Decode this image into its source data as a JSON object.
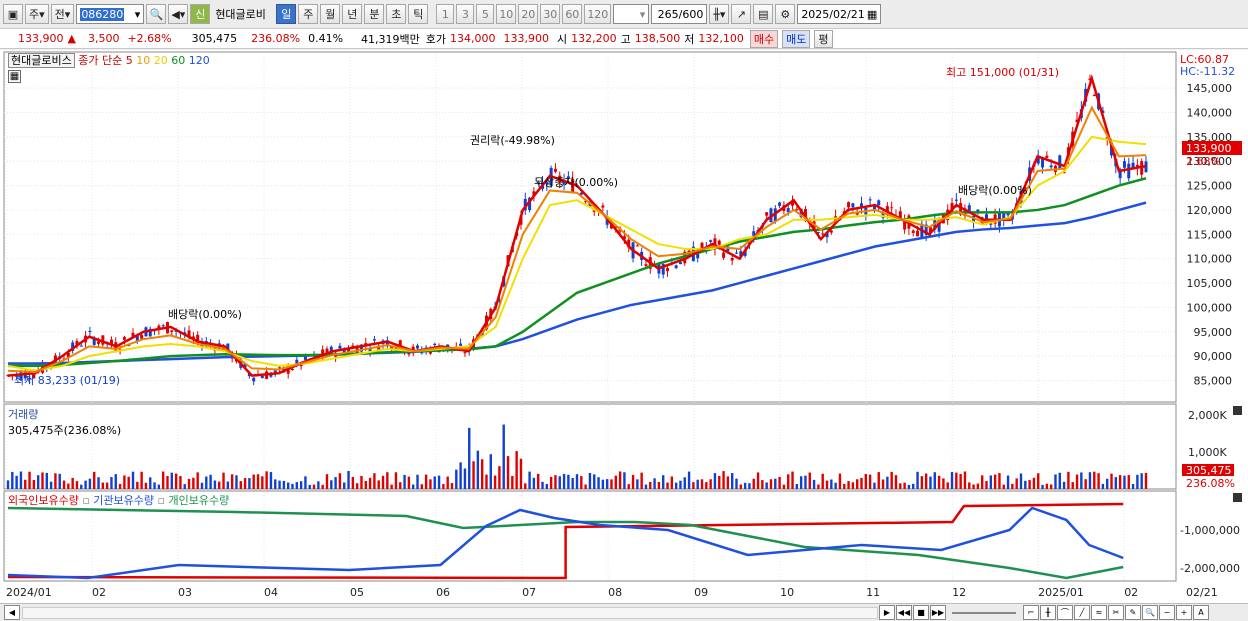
{
  "toolbar": {
    "period_btn": "주",
    "prev_btn": "전",
    "stock_code": "086280",
    "new_badge": "신",
    "stock_name": "현대글로비",
    "tabs": [
      "일",
      "주",
      "월",
      "년",
      "분",
      "초",
      "틱"
    ],
    "active_tab": "일",
    "intervals": [
      "1",
      "3",
      "5",
      "10",
      "20",
      "30",
      "60",
      "120"
    ],
    "count_value": "265",
    "count_total": "/600",
    "date": "2025/02/21"
  },
  "quote": {
    "price": "133,900",
    "change": "3,500",
    "change_pct": "+2.68%",
    "volume": "305,475",
    "volume_ratio": "236.08%",
    "turnover": "0.41%",
    "amount": "41,319백만",
    "bid_label": "호가",
    "bid1": "134,000",
    "bid2": "133,900",
    "open_label": "시",
    "open": "132,200",
    "high_label": "고",
    "high": "138,500",
    "low_label": "저",
    "low": "132,100",
    "buy_btn": "매수",
    "sell_btn": "매도",
    "eval_btn": "평"
  },
  "price_panel": {
    "name_box": "현대글로비스",
    "legend_prefix": "종가 단순",
    "ma_labels": [
      "5",
      "10",
      "20",
      "60",
      "120"
    ],
    "lc": "LC:60.87",
    "hc": "HC:-11.32",
    "current_price_tag": "133,900",
    "current_pct_tag": "2.68%",
    "annotations": {
      "high": "최고 151,000 (01/31)",
      "low": "최저 83,233 (01/19)",
      "div1": "배당락(0.00%)",
      "rights": "권리락(-49.98%)",
      "bonus": "무상증자(0.00%)",
      "div2": "배당락(0.00%)"
    }
  },
  "volume_panel": {
    "title": "거래량",
    "current": "305,475주(236.08%)",
    "axis_labels": [
      "2,000K",
      "1,000K"
    ],
    "tag_value": "305,475",
    "tag_pct": "236.08%"
  },
  "holdings_panel": {
    "legends": [
      "외국인보유수량",
      "기관보유수량",
      "개인보유수량"
    ],
    "axis_labels": [
      "-1,000,000",
      "-2,000,000"
    ]
  },
  "x_axis": [
    "2024/01",
    "02",
    "03",
    "04",
    "05",
    "06",
    "07",
    "08",
    "09",
    "10",
    "11",
    "12",
    "2025/01",
    "02"
  ],
  "x_axis_right": "02/21",
  "colors": {
    "ma5": "#e00000",
    "ma10": "#f08000",
    "ma20": "#f0e000",
    "ma60": "#109020",
    "ma120": "#2050e0",
    "up": "#e00000",
    "down": "#1040d0",
    "foreign": "#e00000",
    "institution": "#2050e0",
    "individual": "#209050"
  },
  "chart_data": {
    "type": "candlestick",
    "y_axis_labels": [
      "145,000",
      "140,000",
      "135,000",
      "130,000",
      "125,000",
      "120,000",
      "115,000",
      "110,000",
      "105,000",
      "100,000",
      "95,000",
      "90,000",
      "85,000"
    ],
    "ylim": [
      81000,
      152000
    ],
    "ma5": [
      86000,
      86500,
      90000,
      94000,
      92000,
      95000,
      96000,
      93000,
      92000,
      86000,
      86500,
      89000,
      91000,
      92000,
      93000,
      91000,
      92000,
      91000,
      100000,
      120000,
      127000,
      125000,
      119000,
      112000,
      108000,
      110000,
      113000,
      110000,
      118000,
      122000,
      114000,
      120000,
      121000,
      118000,
      115000,
      121000,
      118000,
      118000,
      131000,
      129000,
      147000,
      128000,
      129000
    ],
    "ma20": [
      88000,
      87000,
      88000,
      90000,
      91000,
      92000,
      92500,
      92000,
      91000,
      89000,
      88000,
      88500,
      89500,
      90500,
      91500,
      91000,
      91500,
      92000,
      96000,
      110000,
      121000,
      122000,
      119000,
      116000,
      113000,
      112000,
      112000,
      114000,
      115000,
      118000,
      118000,
      118500,
      119000,
      118000,
      118000,
      118500,
      117000,
      118500,
      125000,
      128000,
      135000,
      134000,
      133500
    ],
    "ma60": [
      88000,
      88000,
      88200,
      88600,
      89000,
      89500,
      90000,
      90200,
      90400,
      90300,
      90200,
      90200,
      90300,
      90500,
      90800,
      91000,
      91200,
      91400,
      92000,
      95000,
      99000,
      103000,
      105000,
      107000,
      109000,
      110500,
      112000,
      113500,
      114500,
      115500,
      116000,
      116800,
      117500,
      118000,
      118800,
      119500,
      119500,
      119500,
      120000,
      121000,
      123000,
      125000,
      126500
    ],
    "ma120": [
      88500,
      88500,
      88600,
      88800,
      89000,
      89200,
      89400,
      89600,
      89800,
      89900,
      90000,
      90100,
      90300,
      90500,
      90700,
      90900,
      91200,
      91500,
      92000,
      93500,
      95500,
      97500,
      99000,
      100500,
      101500,
      102500,
      103500,
      105000,
      106500,
      108000,
      109500,
      111000,
      112500,
      113500,
      114500,
      115500,
      116000,
      116300,
      116800,
      117300,
      118500,
      120000,
      121500
    ]
  }
}
